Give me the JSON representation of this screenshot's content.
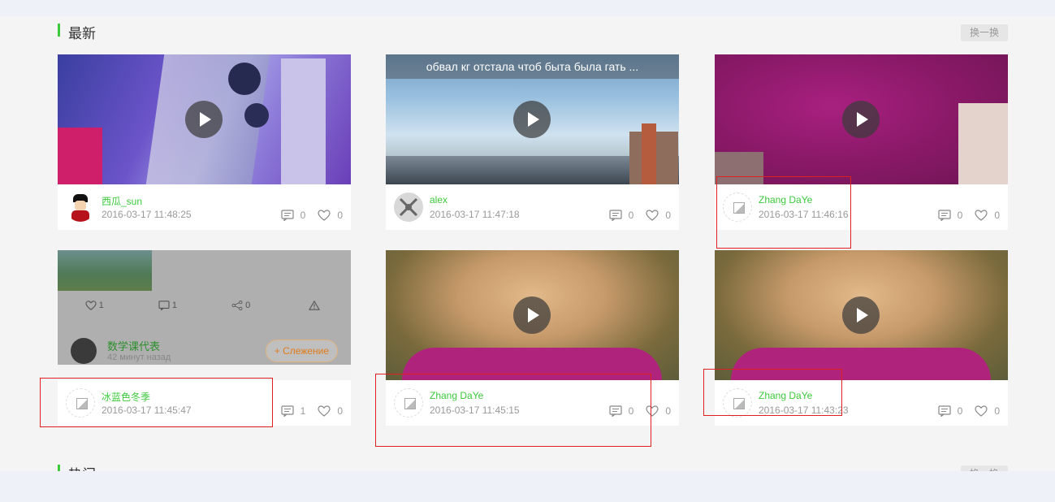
{
  "section_latest": {
    "title": "最新",
    "swap_label": "换一换"
  },
  "section_hot": {
    "title": "热门",
    "swap_label": "换一换"
  },
  "cards": [
    {
      "username": "西瓜_sun",
      "time": "2016-03-17 11:48:25",
      "comments": "0",
      "likes": "0",
      "caption": ""
    },
    {
      "username": "alex",
      "time": "2016-03-17 11:47:18",
      "comments": "0",
      "likes": "0",
      "caption": "обвал кг отстала чтоб быта была гать ..."
    },
    {
      "username": "Zhang DaYe",
      "time": "2016-03-17 11:46:16",
      "comments": "0",
      "likes": "0",
      "caption": ""
    },
    {
      "username": "冰蓝色冬季",
      "time": "2016-03-17 11:45:47",
      "comments": "1",
      "likes": "0",
      "caption": ""
    },
    {
      "username": "Zhang DaYe",
      "time": "2016-03-17 11:45:15",
      "comments": "0",
      "likes": "0",
      "caption": ""
    },
    {
      "username": "Zhang DaYe",
      "time": "2016-03-17 11:43:23",
      "comments": "0",
      "likes": "0",
      "caption": ""
    }
  ],
  "embed": {
    "likes": "1",
    "comments": "1",
    "shares": "0",
    "author": "数学课代表",
    "time_ago": "42 минут назад",
    "follow_label": "+ Слежение"
  },
  "colors": {
    "accent": "#3cc93c",
    "annotation": "#e02020"
  },
  "icons": {
    "comment": "comment-icon",
    "like": "heart-icon",
    "play": "play-icon",
    "share": "share-icon",
    "report": "warning-icon"
  }
}
